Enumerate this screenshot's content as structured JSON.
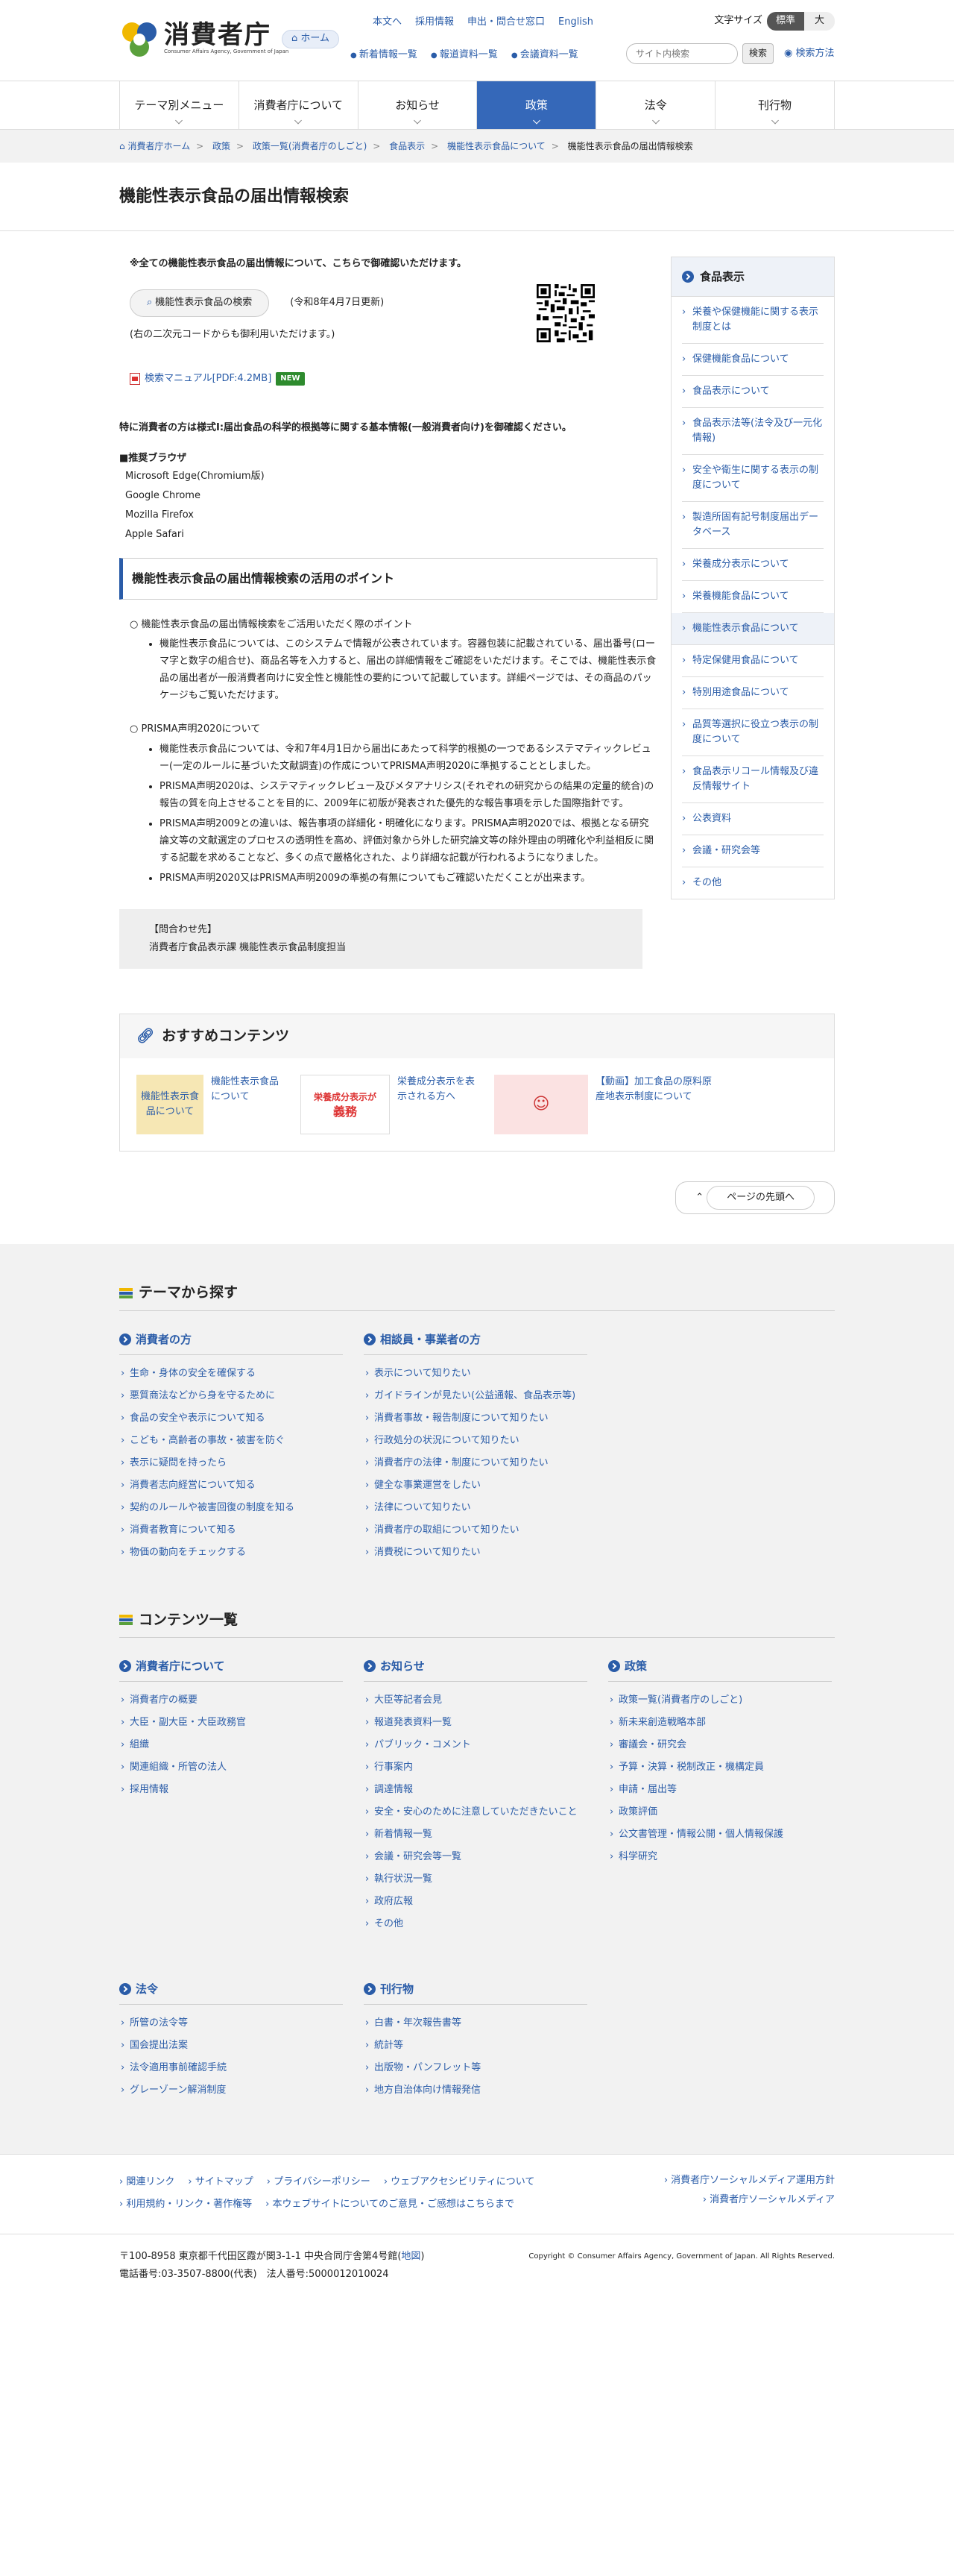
{
  "header": {
    "logo_title": "消費者庁",
    "logo_sub": "Consumer Affairs Agency, Government of Japan",
    "home": "ホーム",
    "toplinks": [
      "本文へ",
      "採用情報",
      "申出・問合せ窓口",
      "English"
    ],
    "fontsize_label": "文字サイズ",
    "fontsize_std": "標準",
    "fontsize_big": "大",
    "sublinks": [
      "新着情報一覧",
      "報道資料一覧",
      "会議資料一覧"
    ],
    "search_placeholder": "サイト内検索",
    "search_btn": "検索",
    "search_method": "検索方法"
  },
  "nav": [
    "テーマ別メニュー",
    "消費者庁について",
    "お知らせ",
    "政策",
    "法令",
    "刊行物"
  ],
  "breadcrumb": [
    "消費者庁ホーム",
    "政策",
    "政策一覧(消費者庁のしごと)",
    "食品表示",
    "機能性表示食品について"
  ],
  "breadcrumb_current": "機能性表示食品の届出情報検索",
  "page_title": "機能性表示食品の届出情報検索",
  "main": {
    "note": "※全ての機能性表示食品の届出情報について、こちらで御確認いただけます。",
    "search_btn": "機能性表示食品の検索",
    "updated": "(令和8年4月7日更新)",
    "qr_note": "(右の二次元コードからも御利用いただけます。)",
    "manual": "検索マニュアル[PDF:4.2MB]",
    "new": "NEW",
    "notice": "特に消費者の方は様式I:届出食品の科学的根拠等に関する基本情報(一般消費者向け)を御確認ください。",
    "browser_head": "■推奨ブラウザ",
    "browsers": [
      "Microsoft Edge(Chromium版)",
      "Google Chrome",
      "Mozilla Firefox",
      "Apple Safari"
    ],
    "points_title": "機能性表示食品の届出情報検索の活用のポイント",
    "block1_head": "○ 機能性表示食品の届出情報検索をご活用いただく際のポイント",
    "block1_items": [
      "機能性表示食品については、このシステムで情報が公表されています。容器包装に記載されている、届出番号(ローマ字と数字の組合せ)、商品名等を入力すると、届出の詳細情報をご確認をいただけます。そこでは、機能性表示食品の届出者が一般消費者向けに安全性と機能性の要約について記載しています。詳細ページでは、その商品のパッケージもご覧いただけます。"
    ],
    "block2_head": "○ PRISMA声明2020について",
    "block2_items": [
      "機能性表示食品については、令和7年4月1日から届出にあたって科学的根拠の一つであるシステマティックレビュー(一定のルールに基づいた文献調査)の作成についてPRISMA声明2020に準拠することとしました。",
      "PRISMA声明2020は、システマティックレビュー及びメタアナリシス(それぞれの研究からの結果の定量的統合)の報告の質を向上させることを目的に、2009年に初版が発表された優先的な報告事項を示した国際指針です。",
      "PRISMA声明2009との違いは、報告事項の詳細化・明確化になります。PRISMA声明2020では、根拠となる研究論文等の文献選定のプロセスの透明性を高め、評価対象から外した研究論文等の除外理由の明確化や利益相反に関する記載を求めることなど、多くの点で厳格化された、より詳細な記載が行われるようになりました。",
      "PRISMA声明2020又はPRISMA声明2009の準拠の有無についてもご確認いただくことが出来ます。"
    ],
    "inquiry_label": "【問合わせ先】",
    "inquiry": "消費者庁食品表示課 機能性表示食品制度担当"
  },
  "side": {
    "title": "食品表示",
    "items": [
      "栄養や保健機能に関する表示制度とは",
      "保健機能食品について",
      "食品表示について",
      "食品表示法等(法令及び一元化情報)",
      "安全や衛生に関する表示の制度について",
      "製造所固有記号制度届出データベース",
      "栄養成分表示について",
      "栄養機能食品について",
      "機能性表示食品について",
      "特定保健用食品について",
      "特別用途食品について",
      "品質等選択に役立つ表示の制度について",
      "食品表示リコール情報及び違反情報サイト",
      "公表資料",
      "会議・研究会等",
      "その他"
    ],
    "active_index": 8
  },
  "recommend": {
    "title": "おすすめコンテンツ",
    "thumb1": "機能性表示食品について",
    "thumb2_title": "栄養成分表示が",
    "thumb2_sub": "義務",
    "items": [
      "機能性表示食品について",
      "栄養成分表示を表示される方へ",
      "【動画】加工食品の原料原産地表示制度について"
    ]
  },
  "pagetop": "ページの先頭へ",
  "theme": {
    "title": "テーマから探す",
    "cols": [
      {
        "head": "消費者の方",
        "items": [
          "生命・身体の安全を確保する",
          "悪質商法などから身を守るために",
          "食品の安全や表示について知る",
          "こども・高齢者の事故・被害を防ぐ",
          "表示に疑問を持ったら",
          "消費者志向経営について知る",
          "契約のルールや被害回復の制度を知る",
          "消費者教育について知る",
          "物価の動向をチェックする"
        ]
      },
      {
        "head": "相談員・事業者の方",
        "items": [
          "表示について知りたい",
          "ガイドラインが見たい(公益通報、食品表示等)",
          "消費者事故・報告制度について知りたい",
          "行政処分の状況について知りたい",
          "消費者庁の法律・制度について知りたい",
          "健全な事業運営をしたい",
          "法律について知りたい",
          "消費者庁の取組について知りたい",
          "消費税について知りたい"
        ]
      }
    ]
  },
  "contents": {
    "title": "コンテンツ一覧",
    "cols": [
      {
        "head": "消費者庁について",
        "items": [
          "消費者庁の概要",
          "大臣・副大臣・大臣政務官",
          "組織",
          "関連組織・所管の法人",
          "採用情報"
        ]
      },
      {
        "head": "お知らせ",
        "items": [
          "大臣等記者会見",
          "報道発表資料一覧",
          "パブリック・コメント",
          "行事案内",
          "調達情報",
          "安全・安心のために注意していただきたいこと",
          "新着情報一覧",
          "会議・研究会等一覧",
          "執行状況一覧",
          "政府広報",
          "その他"
        ]
      },
      {
        "head": "政策",
        "items": [
          "政策一覧(消費者庁のしごと)",
          "新未来創造戦略本部",
          "審議会・研究会",
          "予算・決算・税制改正・機構定員",
          "申請・届出等",
          "政策評価",
          "公文書管理・情報公開・個人情報保護",
          "科学研究"
        ]
      }
    ],
    "cols2": [
      {
        "head": "法令",
        "items": [
          "所管の法令等",
          "国会提出法案",
          "法令適用事前確認手続",
          "グレーゾーン解消制度"
        ]
      },
      {
        "head": "刊行物",
        "items": [
          "白書・年次報告書等",
          "統計等",
          "出版物・パンフレット等",
          "地方自治体向け情報発信"
        ]
      }
    ]
  },
  "footer": {
    "links1": [
      "関連リンク",
      "サイトマップ",
      "プライバシーポリシー",
      "ウェブアクセシビリティについて"
    ],
    "links2": [
      "利用規約・リンク・著作権等",
      "本ウェブサイトについてのご意見・ご感想はこちらまで"
    ],
    "right": [
      "消費者庁ソーシャルメディア運用方針",
      "消費者庁ソーシャルメディア"
    ],
    "address": "〒100-8958 東京都千代田区霞が関3-1-1 中央合同庁舎第4号館(",
    "map": "地図",
    "address_end": ")",
    "tel": "電話番号:03-3507-8800(代表)　法人番号:5000012010024",
    "copyright": "Copyright © Consumer Affairs Agency, Government of Japan. All Rights Reserved."
  }
}
